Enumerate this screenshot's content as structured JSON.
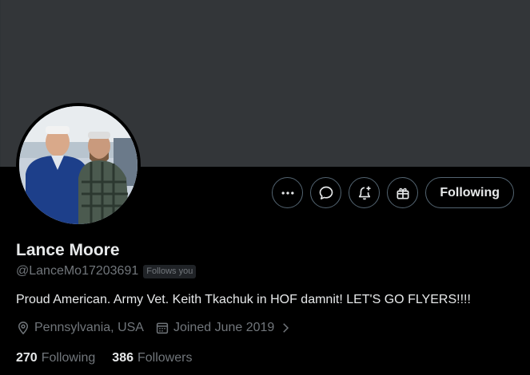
{
  "profile": {
    "display_name": "Lance Moore",
    "handle": "@LanceMo17203691",
    "follows_you_badge": "Follows you",
    "bio": "Proud American. Army Vet. Keith Tkachuk in HOF damnit! LET'S GO FLYERS!!!!",
    "location": "Pennsylvania, USA",
    "joined": "Joined June 2019"
  },
  "actions": {
    "follow_label": "Following"
  },
  "stats": {
    "following_count": "270",
    "following_label": "Following",
    "followers_count": "386",
    "followers_label": "Followers"
  },
  "icons": {
    "more": "more-dots-icon",
    "message": "message-bubble-icon",
    "notify": "bell-plus-icon",
    "gift": "gift-icon",
    "location": "location-pin-icon",
    "calendar": "calendar-icon",
    "chevron": "chevron-right-icon"
  },
  "colors": {
    "background": "#000000",
    "banner": "#333639",
    "text_primary": "#e7e9ea",
    "text_secondary": "#71767b",
    "button_border": "#536471"
  }
}
